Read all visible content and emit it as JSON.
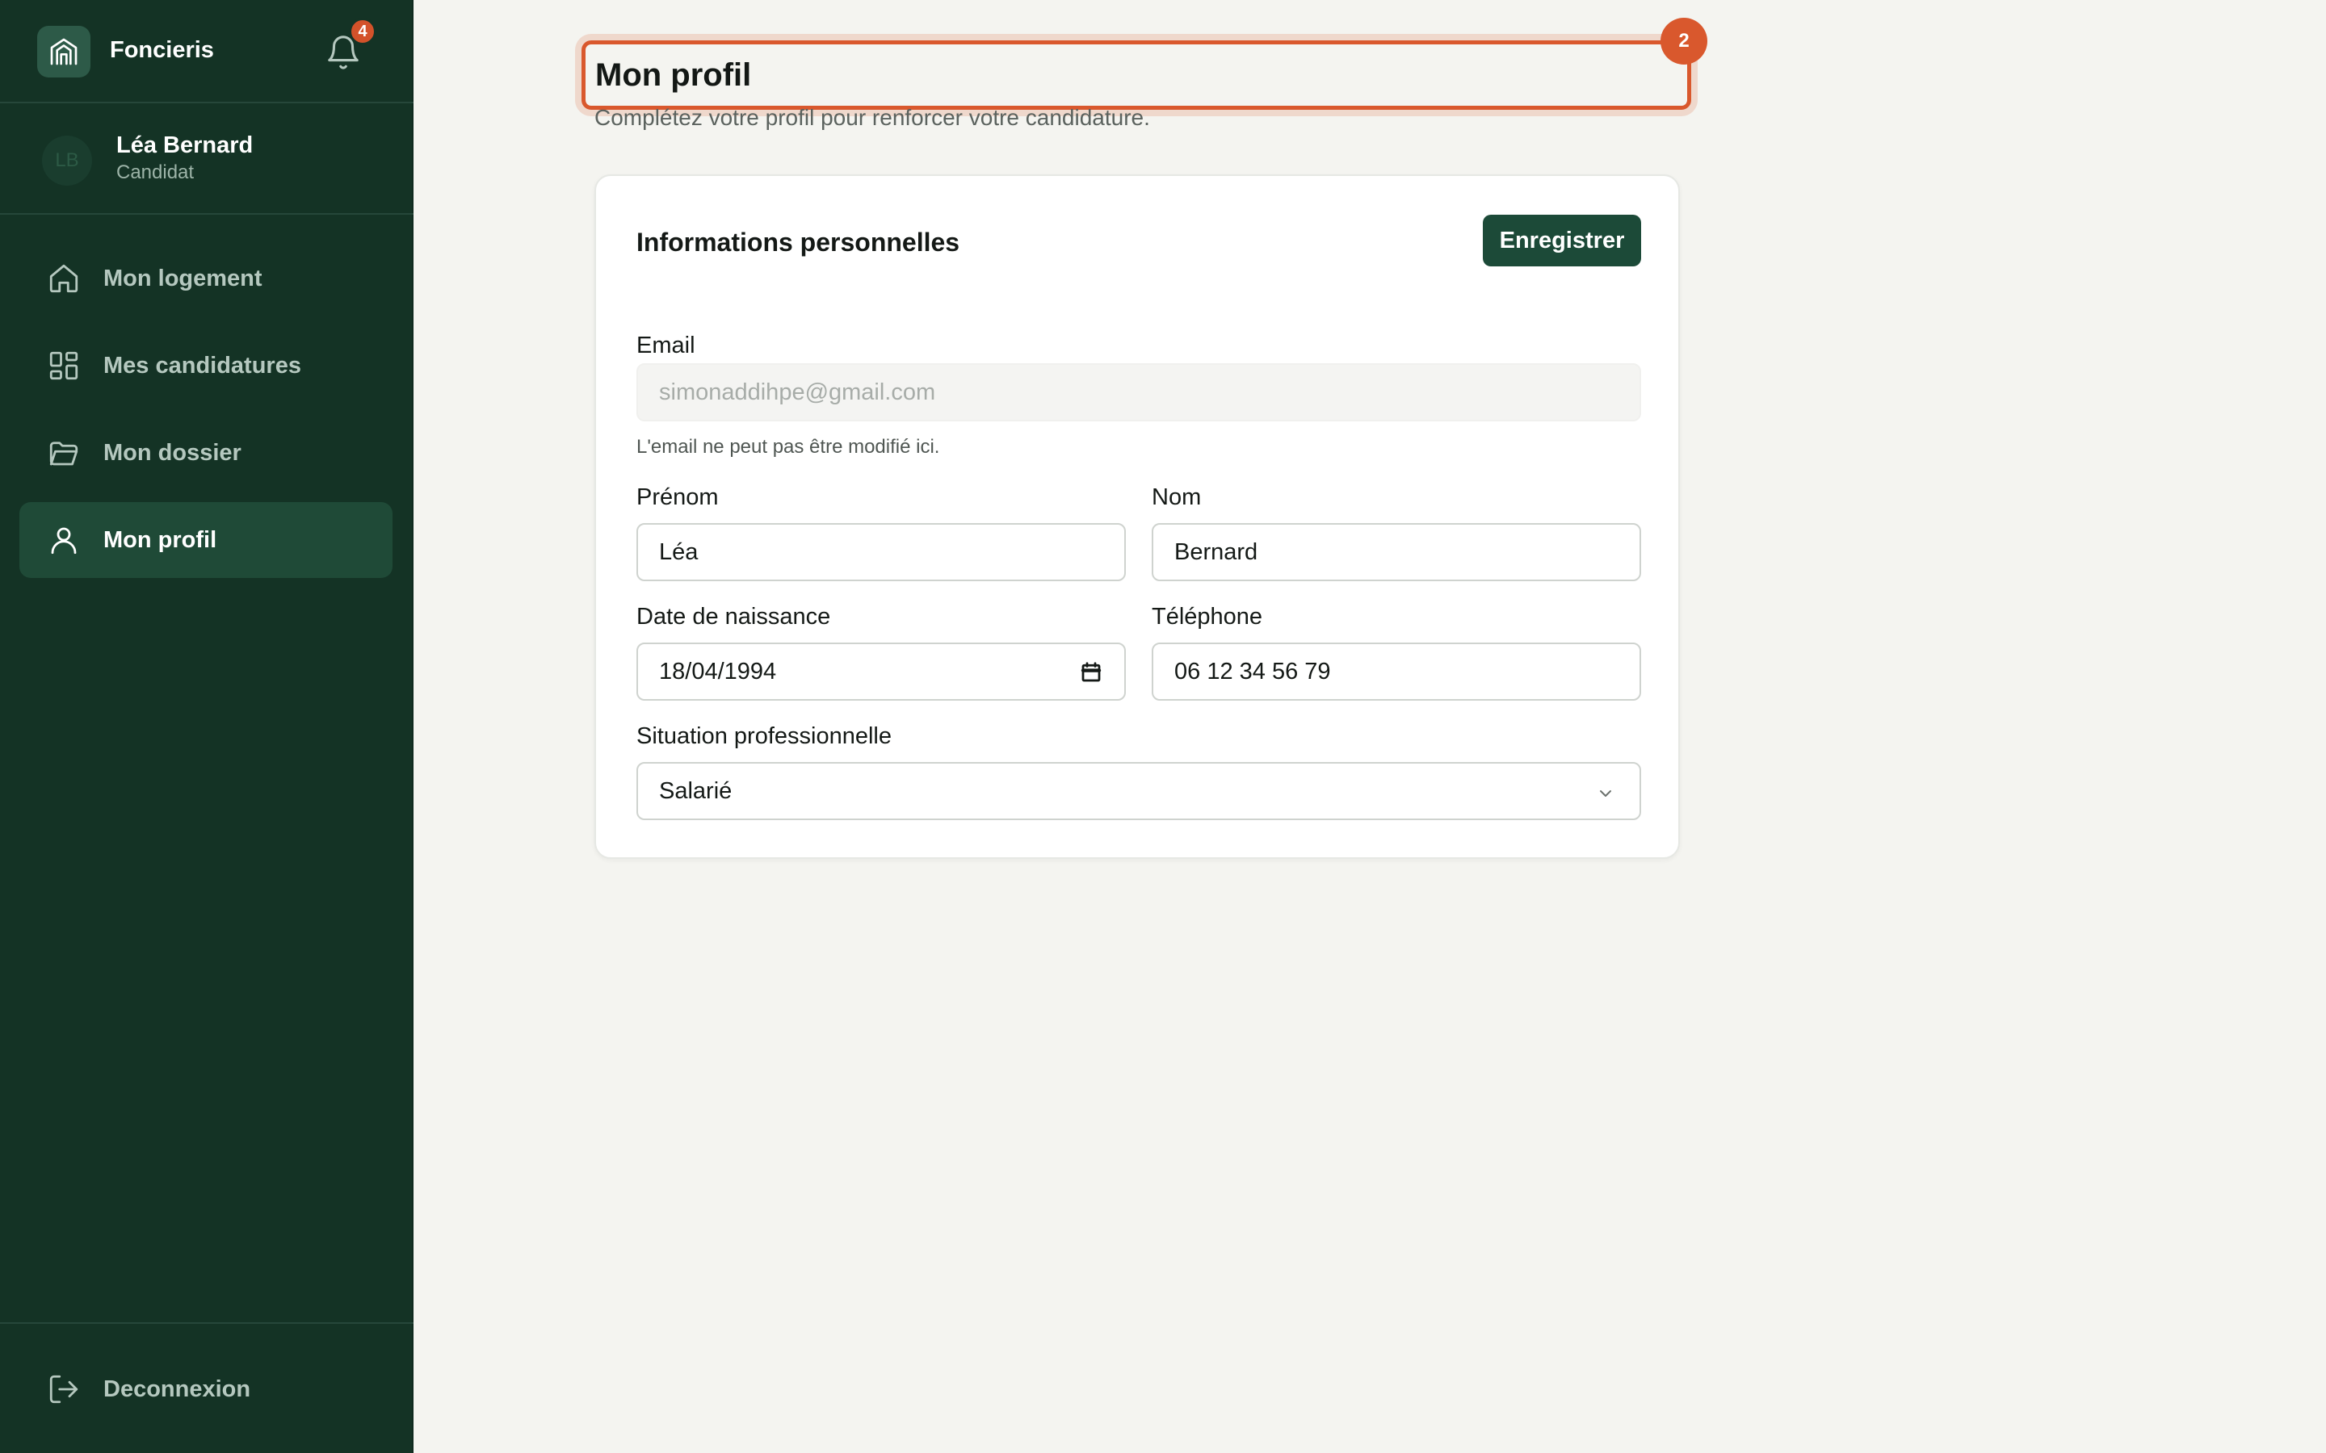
{
  "app": {
    "name": "Foncieris",
    "notification_count": "4"
  },
  "user": {
    "initials": "LB",
    "name": "Léa Bernard",
    "role": "Candidat"
  },
  "nav": {
    "items": [
      {
        "label": "Mon logement",
        "icon": "home-icon"
      },
      {
        "label": "Mes candidatures",
        "icon": "grid-icon"
      },
      {
        "label": "Mon dossier",
        "icon": "folder-icon"
      },
      {
        "label": "Mon profil",
        "icon": "user-icon",
        "active": true
      }
    ],
    "logout_label": "Deconnexion"
  },
  "page": {
    "title": "Mon profil",
    "step_badge": "2",
    "subtitle": "Complétez votre profil pour renforcer votre candidature."
  },
  "card": {
    "title": "Informations personnelles",
    "save_label": "Enregistrer",
    "email": {
      "label": "Email",
      "value": "simonaddihpe@gmail.com",
      "hint": "L'email ne peut pas être modifié ici."
    },
    "first_name": {
      "label": "Prénom",
      "value": "Léa"
    },
    "last_name": {
      "label": "Nom",
      "value": "Bernard"
    },
    "birth_date": {
      "label": "Date de naissance",
      "value": "18/04/1994"
    },
    "phone": {
      "label": "Téléphone",
      "value": "06 12 34 56 79"
    },
    "job_status": {
      "label": "Situation professionnelle",
      "value": "Salarié"
    }
  },
  "colors": {
    "sidebar_bg": "#143325",
    "accent": "#d9582d",
    "primary_button": "#1c4a38",
    "page_bg": "#f4f4f0"
  }
}
